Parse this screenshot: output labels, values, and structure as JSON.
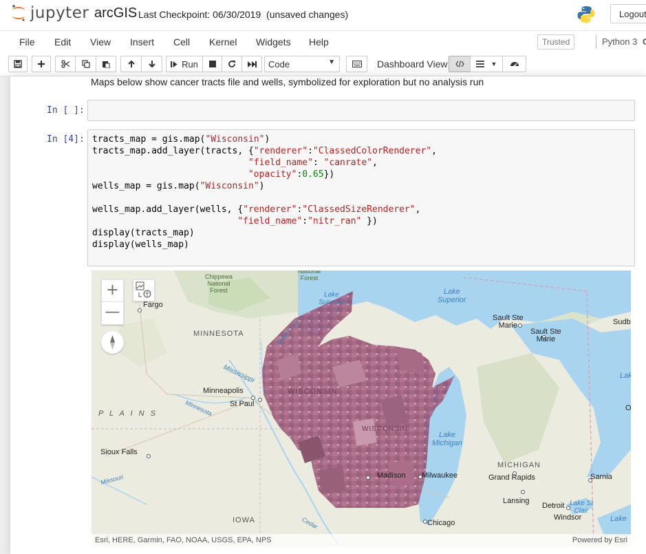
{
  "header": {
    "logo_text": "jupyter",
    "notebook_name": "arcGIS",
    "checkpoint": "Last Checkpoint: 06/30/2019",
    "save_status": "(unsaved changes)",
    "logout_label": "Logout"
  },
  "menu": {
    "items": [
      "File",
      "Edit",
      "View",
      "Insert",
      "Cell",
      "Kernel",
      "Widgets",
      "Help"
    ],
    "trusted": "Trusted",
    "kernel": "Python 3",
    "kernel_indicator": "C"
  },
  "toolbar": {
    "run_label": "Run",
    "cell_type": "Code",
    "dashboard_label": "Dashboard View:",
    "icons": [
      "save-icon",
      "plus-icon",
      "cut-icon",
      "copy-icon",
      "paste-icon",
      "arrow-up-icon",
      "arrow-down-icon",
      "run-icon",
      "stop-icon",
      "restart-icon",
      "fast-forward-icon",
      "keyboard-icon",
      "code-icon",
      "list-icon",
      "dashboard-icon"
    ]
  },
  "cells": {
    "markdown": "Maps below show cancer tracts file and wells, symbolized for exploration but no analysis run",
    "empty_prompt": "In [ ]:",
    "code_prompt": "In [4]:"
  },
  "map": {
    "attribution": "Esri, HERE, Garmin, FAO, NOAA, USGS, EPA, NPS",
    "powered_by": "Powered by Esri",
    "labels": {
      "fargo": "Fargo",
      "minneapolis": "Minneapolis",
      "st_paul": "St Paul",
      "sioux_falls": "Sioux Falls",
      "sault_ste_marie_1": "Sault Ste\nMarie",
      "sault_ste_marie_2": "Sault Ste\nMarie",
      "sudbury": "Sudb",
      "milwaukee": "Milwaukee",
      "madison": "Madison",
      "chicago": "Chicago",
      "grand_rapids": "Grand Rapids",
      "lansing": "Lansing",
      "detroit": "Detroit",
      "windsor": "Windsor",
      "sarnia": "Sarnia",
      "o_edge": "O",
      "minnesota": "MINNESOTA",
      "wisconsin": "WISCONSIN",
      "wisconsin_river": "WISCONSIN",
      "michigan": "MICHIGAN",
      "iowa": "IOWA",
      "plains": "P L A I N S",
      "lake_superior": "Lake\nSuperior",
      "lake_superior_small": "Lake\nSuperior",
      "lake_michigan": "Lake\nMichigan",
      "lake_right": "Lake",
      "lake_st_clair": "Lake St\nClair",
      "lake_bottom": "Lake",
      "mississippi": "Mississippi",
      "minnesota_river": "Minnesota",
      "missouri": "Missouri",
      "cedar": "Cedar",
      "saint_croix": "Saint Croix",
      "chippewa": "Chippewa\nNational\nForest",
      "national_forest": "National\nForest"
    }
  }
}
